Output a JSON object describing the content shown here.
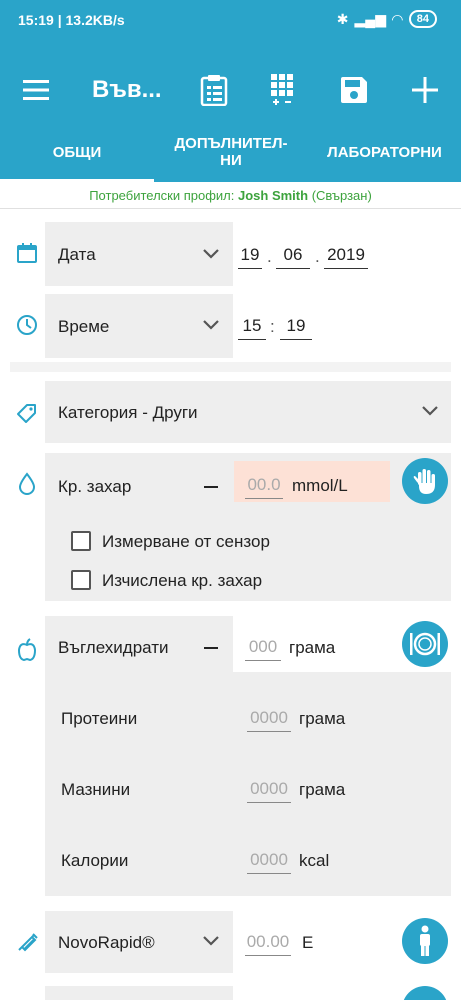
{
  "status": {
    "time_speed": "15:19 | 13.2KB/s",
    "battery": "84"
  },
  "appbar": {
    "title": "Във..."
  },
  "tabs": [
    {
      "label": "ОБЩИ"
    },
    {
      "label": "ДОПЪЛНИТЕЛ-\nНИ"
    },
    {
      "label": "ЛАБОРАТОРНИ"
    }
  ],
  "profile": {
    "prefix": "Потребителски профил: ",
    "name": "Josh Smith",
    "suffix": " (Свързан)"
  },
  "date": {
    "label": "Дата",
    "day": "19",
    "month": "06",
    "year": "2019",
    "sep": "."
  },
  "time": {
    "label": "Време",
    "hour": "15",
    "minute": "19",
    "sep": ":"
  },
  "category": {
    "label": "Категория - Други"
  },
  "glucose": {
    "label": "Кр. захар",
    "placeholder": "00.0",
    "unit": "mmol/L"
  },
  "checkboxes": [
    {
      "label": "Измерване от сензор"
    },
    {
      "label": "Изчислена кр. захар"
    }
  ],
  "carbs": {
    "label": "Въглехидрати",
    "placeholder": "000",
    "unit": "грама"
  },
  "nutrients": [
    {
      "label": "Протеини",
      "placeholder": "0000",
      "unit": "грама"
    },
    {
      "label": "Мазнини",
      "placeholder": "0000",
      "unit": "грама"
    },
    {
      "label": "Калории",
      "placeholder": "0000",
      "unit": "kcal"
    }
  ],
  "insulin": {
    "label": "NovoRapid®",
    "placeholder": "00.00",
    "unit": "Е"
  },
  "colors": {
    "primary": "#2aa4c9",
    "highlight": "#fde1d6",
    "profile": "#3da33d"
  }
}
